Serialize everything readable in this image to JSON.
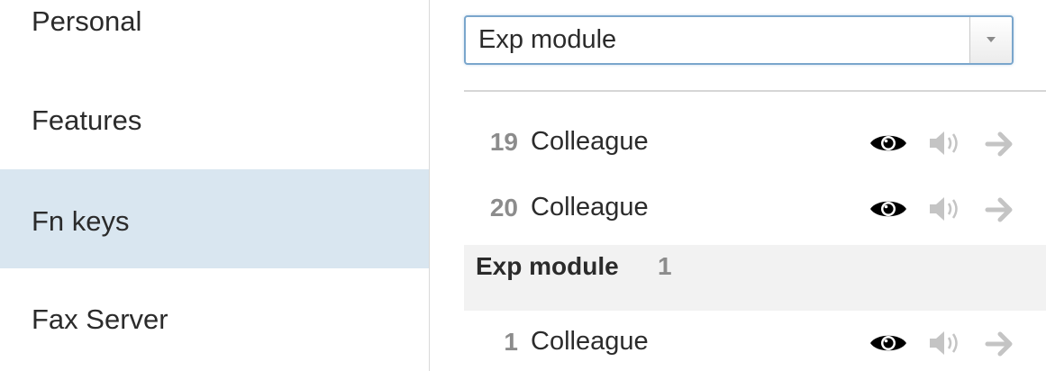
{
  "sidebar": {
    "items": [
      {
        "label": "Personal",
        "active": false
      },
      {
        "label": "Features",
        "active": false
      },
      {
        "label": "Fn keys",
        "active": true
      },
      {
        "label": "Fax Server",
        "active": false
      }
    ]
  },
  "module_select": {
    "value": "Exp module"
  },
  "rows_top": [
    {
      "number": "19",
      "name": "Colleague"
    },
    {
      "number": "20",
      "name": "Colleague"
    }
  ],
  "group": {
    "title": "Exp module",
    "count": "1"
  },
  "rows_group": [
    {
      "number": "1",
      "name": "Colleague"
    }
  ],
  "icons": {
    "view": "eye-icon",
    "sound": "speaker-icon",
    "forward": "arrow-right-icon"
  },
  "colors": {
    "active_item_bg": "#d9e6f0",
    "select_border": "#7aa6cc",
    "muted_icon": "#c4c4c4",
    "group_bg": "#f2f2f2"
  }
}
